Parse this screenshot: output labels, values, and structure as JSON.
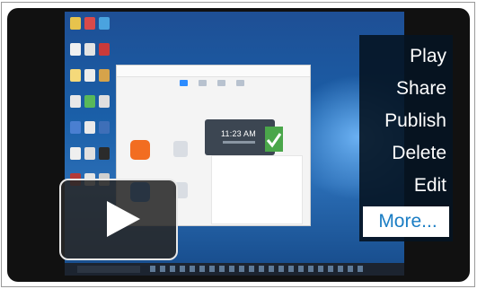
{
  "video": {
    "thumbnail": {
      "clock_time": "11:23 AM"
    },
    "play_icon": "play-triangle-icon"
  },
  "menu": {
    "items": [
      {
        "label": "Play"
      },
      {
        "label": "Share"
      },
      {
        "label": "Publish"
      },
      {
        "label": "Delete"
      },
      {
        "label": "Edit"
      },
      {
        "label": "More...",
        "highlighted": true
      }
    ]
  },
  "colors": {
    "menu_background": "#061422",
    "menu_highlight_text": "#1a7dc4",
    "desktop_blue": "#1a5fa8",
    "accent_orange": "#f26d21",
    "accent_blue": "#2d8cff"
  }
}
